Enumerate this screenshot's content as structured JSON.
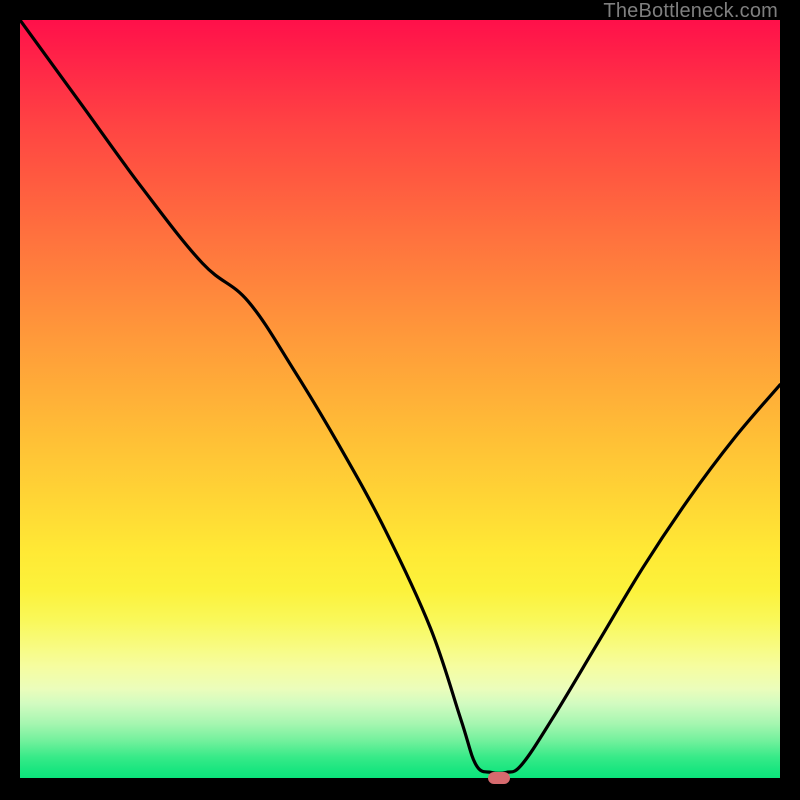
{
  "watermark": "TheBottleneck.com",
  "marker": {
    "x_frac": 0.63,
    "y_frac": 0.997
  },
  "chart_data": {
    "type": "line",
    "title": "",
    "xlabel": "",
    "ylabel": "",
    "xlim": [
      0,
      100
    ],
    "ylim": [
      0,
      100
    ],
    "grid": false,
    "legend": false,
    "series": [
      {
        "name": "bottleneck-curve",
        "x": [
          0,
          8,
          16,
          24,
          30,
          36,
          42,
          48,
          54,
          58,
          60,
          62,
          64,
          66,
          70,
          76,
          82,
          88,
          94,
          100
        ],
        "y": [
          100,
          89,
          78,
          68,
          63,
          54,
          44,
          33,
          20,
          8,
          2,
          1,
          1,
          2,
          8,
          18,
          28,
          37,
          45,
          52
        ]
      }
    ],
    "background_gradient_stops": [
      {
        "pos": 0.0,
        "color": "#ff104a"
      },
      {
        "pos": 0.5,
        "color": "#ffae38"
      },
      {
        "pos": 0.8,
        "color": "#f9f85a"
      },
      {
        "pos": 0.92,
        "color": "#a7f6b1"
      },
      {
        "pos": 1.0,
        "color": "#08e27a"
      }
    ],
    "marker": {
      "x": 63,
      "y": 0.3,
      "color": "#d66a6e"
    }
  }
}
